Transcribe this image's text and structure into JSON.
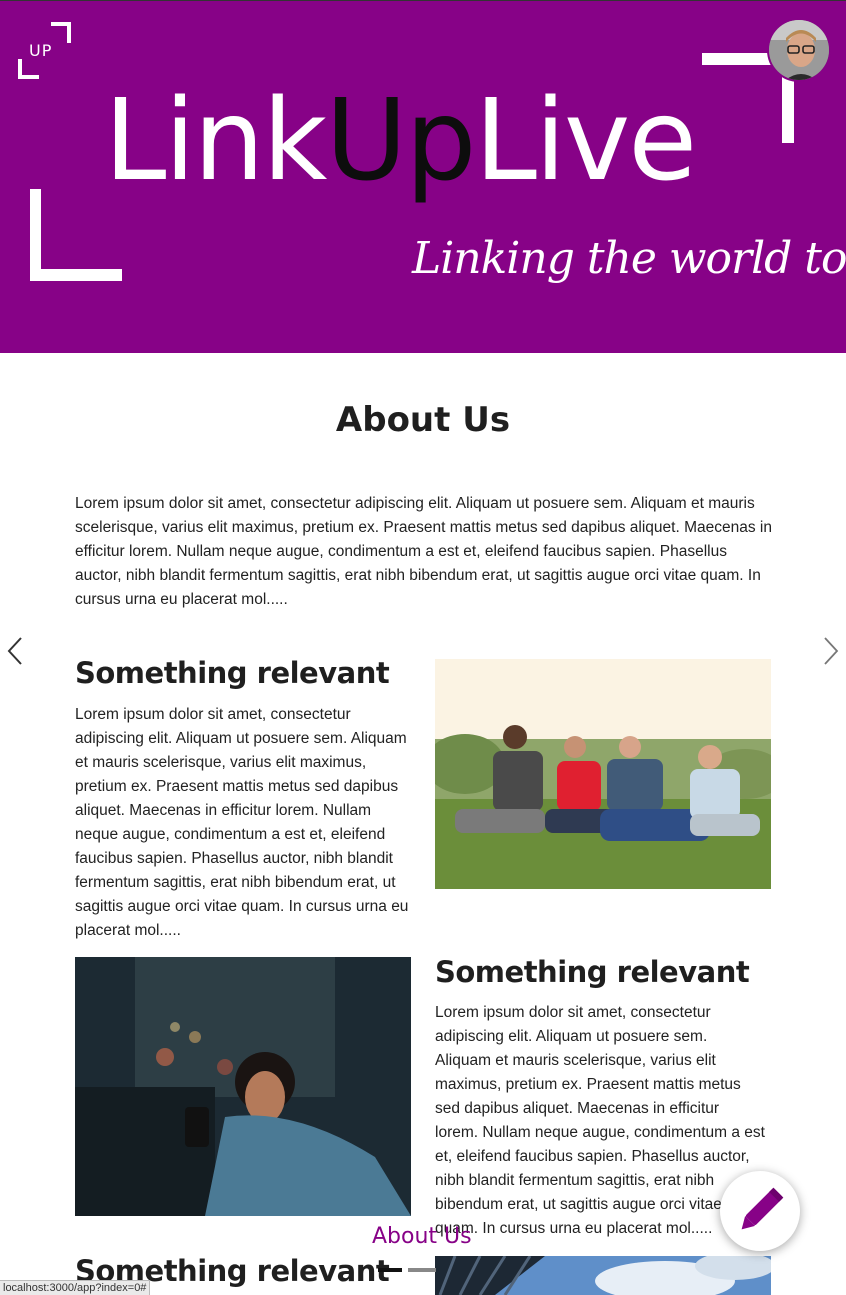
{
  "header": {
    "logo_text": "UP",
    "brand": {
      "part1": "Link",
      "part2": "Up",
      "part3": "Live"
    },
    "tagline": "Linking the world together",
    "avatar": "user-avatar"
  },
  "main": {
    "title": "About Us",
    "intro": "Lorem ipsum dolor sit amet, consectetur adipiscing elit. Aliquam ut posuere sem. Aliquam et mauris scelerisque, varius elit maximus, pretium ex. Praesent mattis metus sed dapibus aliquet. Maecenas in efficitur lorem. Nullam neque augue, condimentum a est et, eleifend faucibus sapien. Phasellus auctor, nibh blandit fermentum sagittis, erat nibh bibendum erat, ut sagittis augue orci vitae quam. In cursus urna eu placerat mol.....",
    "sections": [
      {
        "title": "Something relevant",
        "text": "Lorem ipsum dolor sit amet, consectetur adipiscing elit. Aliquam ut posuere sem. Aliquam et mauris scelerisque, varius elit maximus, pretium ex. Praesent mattis metus sed dapibus aliquet. Maecenas in efficitur lorem. Nullam neque augue, condimentum a est et, eleifend faucibus sapien. Phasellus auctor, nibh blandit fermentum sagittis, erat nibh bibendum erat, ut sagittis augue orci vitae quam. In cursus urna eu placerat mol.....",
        "image": "friends-sitting-on-grass-photo"
      },
      {
        "title": "Something relevant",
        "text": "Lorem ipsum dolor sit amet, consectetur adipiscing elit. Aliquam ut posuere sem. Aliquam et mauris scelerisque, varius elit maximus, pretium ex. Praesent mattis metus sed dapibus aliquet. Maecenas in efficitur lorem. Nullam neque augue, condimentum a est et, eleifend faucibus sapien. Phasellus auctor, nibh blandit fermentum sagittis, erat nibh bibendum erat, ut sagittis augue orci vitae quam. In cursus urna eu placerat mol.....",
        "image": "woman-looking-at-phone-photo"
      },
      {
        "title": "Something relevant",
        "image": "building-and-sky-photo"
      }
    ]
  },
  "carousel": {
    "prev_icon": "chevron-left-icon",
    "next_icon": "chevron-right-icon"
  },
  "floating": {
    "edit_icon": "pencil-icon",
    "overlay_label": "About Us"
  },
  "status_bar": {
    "url": "localhost:3000/app?index=0#"
  },
  "colors": {
    "brand_purple": "#870287",
    "text": "#222222",
    "heading": "#1f1f1f"
  }
}
